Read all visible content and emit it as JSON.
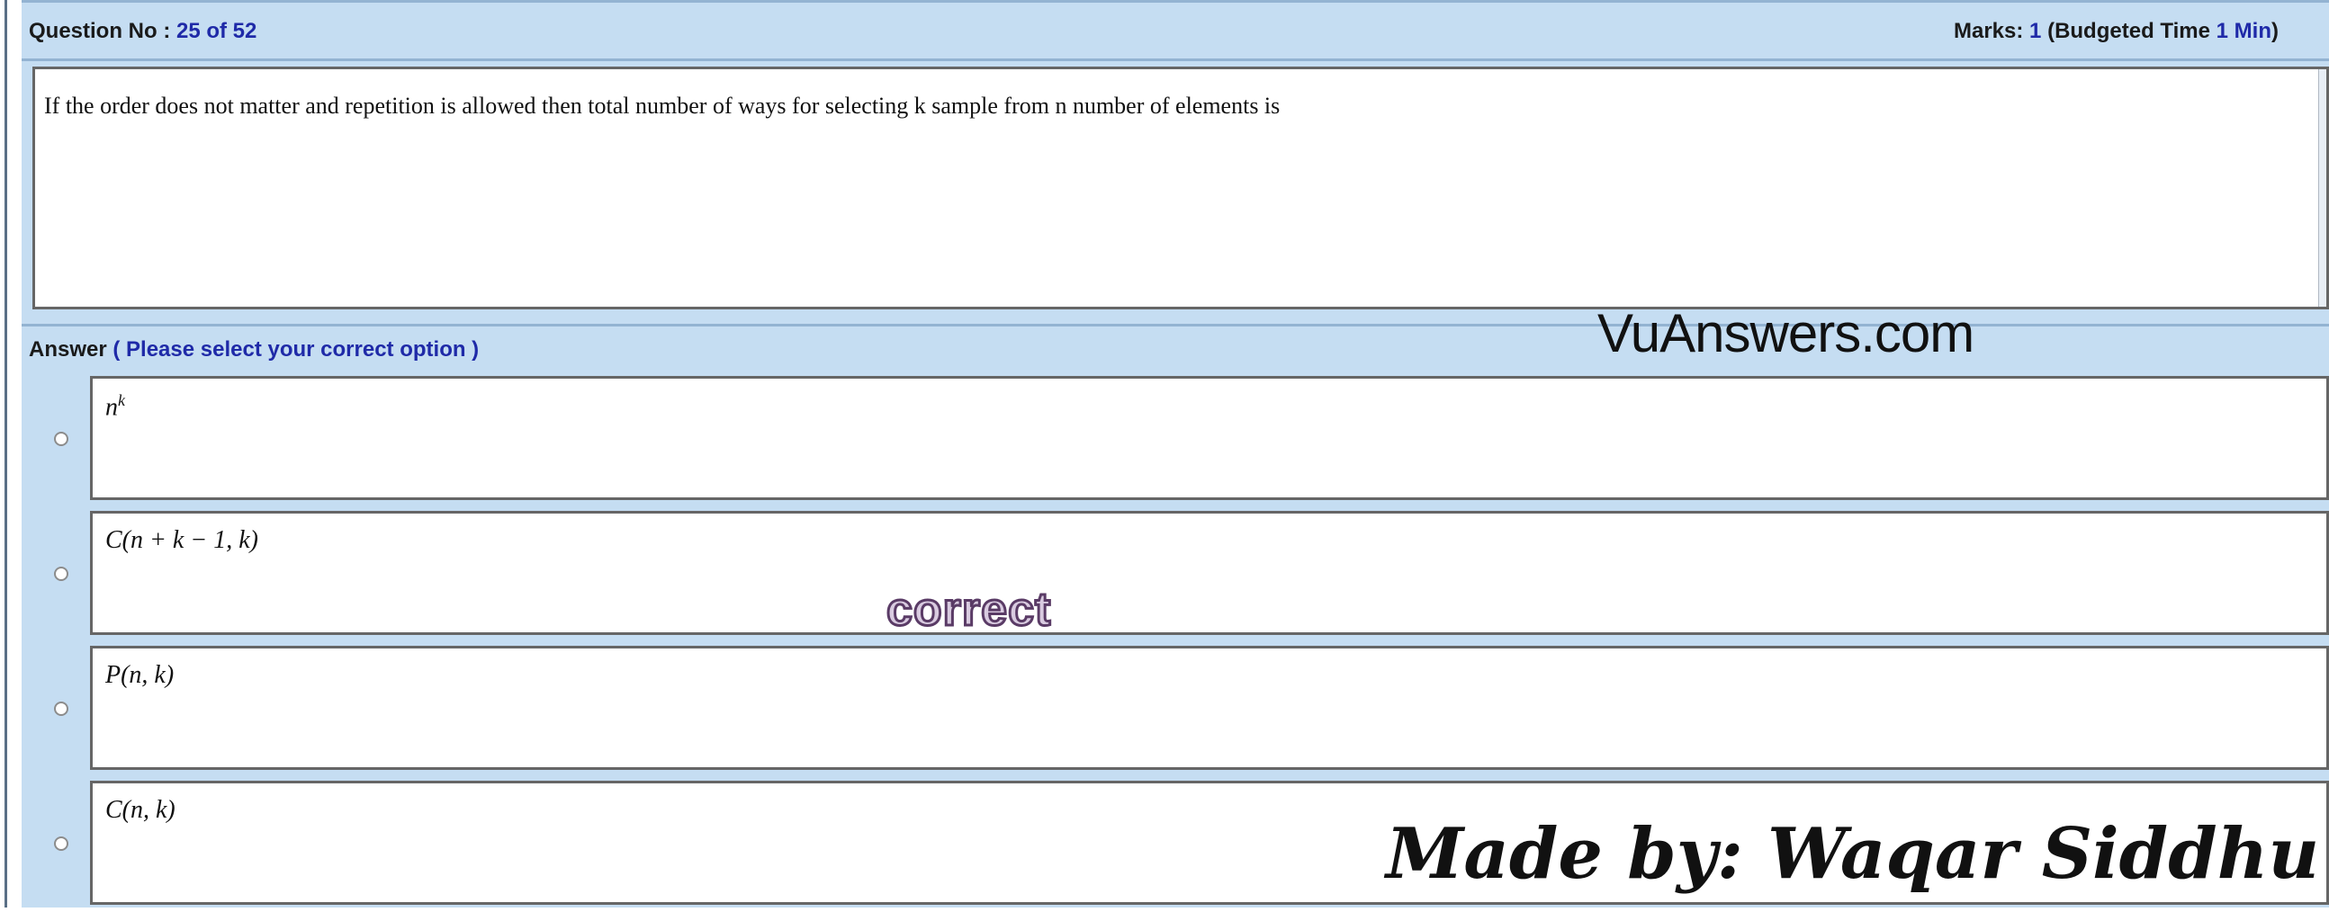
{
  "question_bar": {
    "label": "Question No : ",
    "number": "25 of 52",
    "marks_label": "Marks: ",
    "marks_value": "1",
    "budget_label": " (Budgeted Time ",
    "budget_value": "1 Min",
    "budget_close": ")"
  },
  "question": {
    "text": "If the order does not matter and repetition is allowed then total number of ways for selecting k sample from n number of elements is"
  },
  "answer_bar": {
    "label": "Answer ",
    "hint": "( Please select your correct option )"
  },
  "watermark": "VuAnswers.com",
  "options": [
    {
      "base": "n",
      "sup": "k"
    },
    {
      "text": "C(n + k − 1, k)"
    },
    {
      "text": "P(n, k)"
    },
    {
      "text": "C(n, k)"
    }
  ],
  "correct_stamp": "correct",
  "signature": "Made by: Waqar Siddhu"
}
